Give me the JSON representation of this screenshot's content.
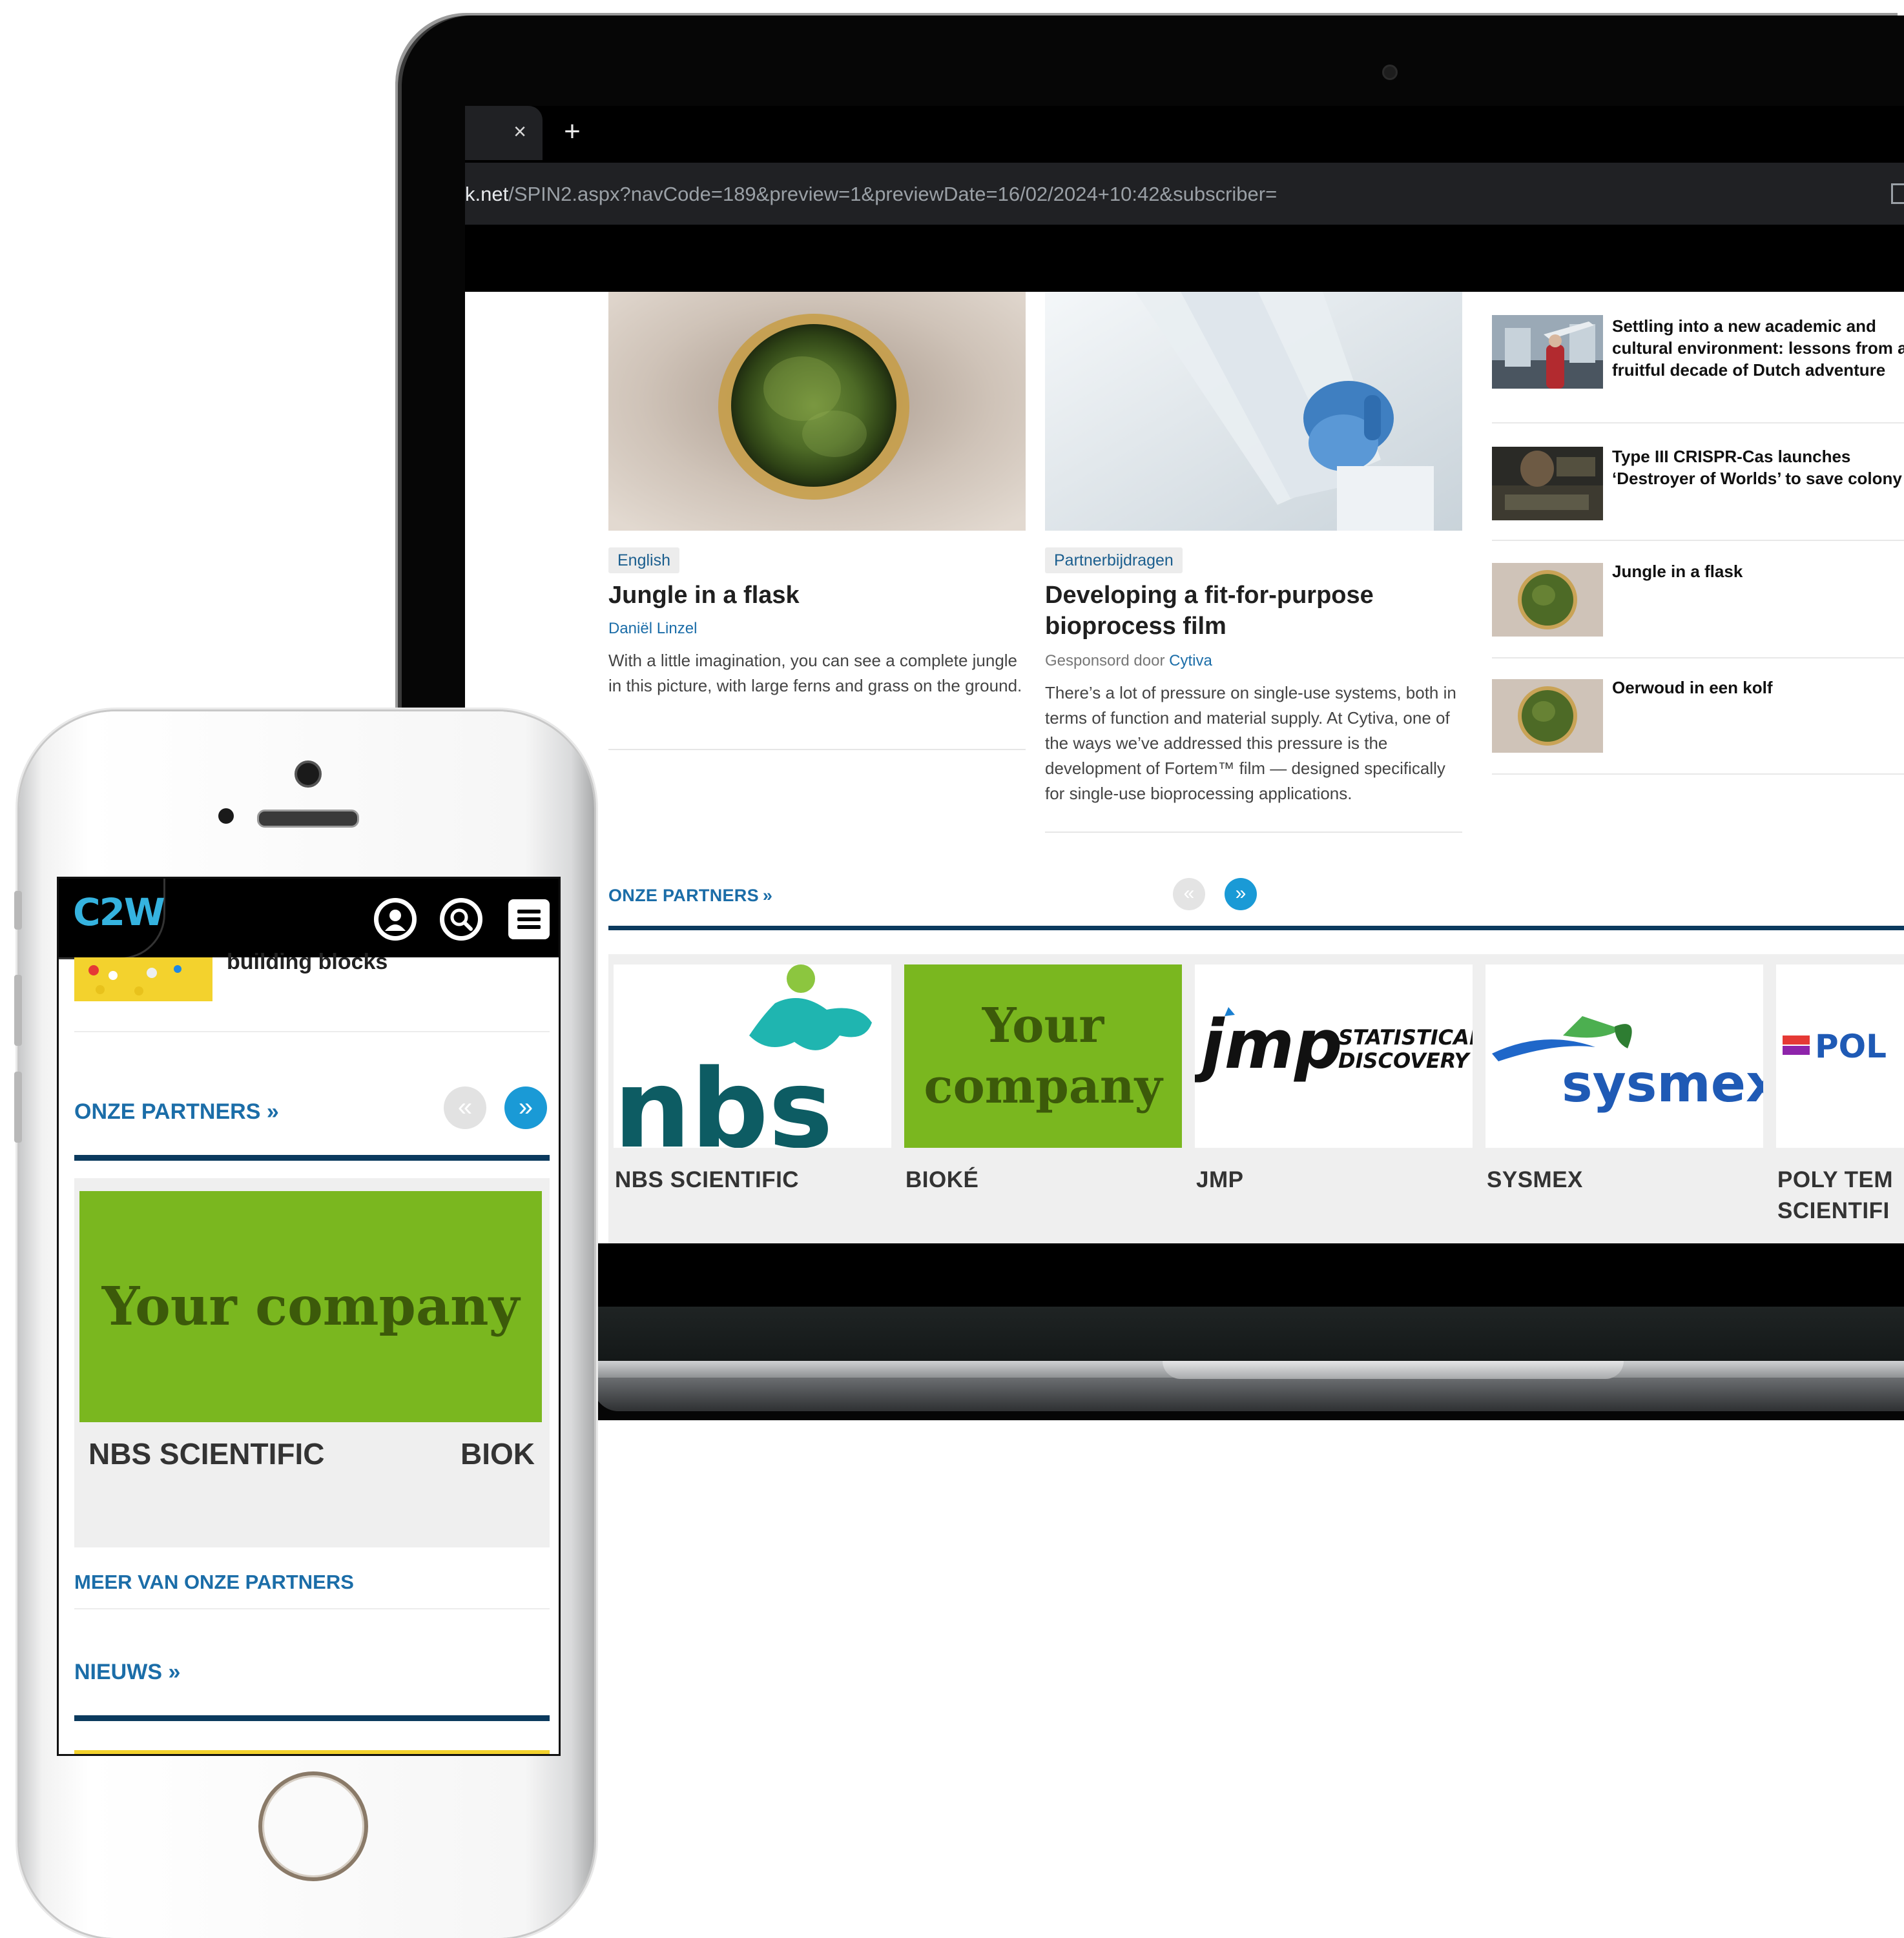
{
  "browser": {
    "tab_close": "×",
    "new_tab": "+",
    "address_host": "k.net",
    "address_path": "/SPIN2.aspx?navCode=189&preview=1&previewDate=16/02/2024+10:42&subscriber="
  },
  "articles": [
    {
      "tag": "English",
      "title": "Jungle in a flask",
      "author": "Daniël Linzel",
      "body": "With a little imagination, you can see a complete jungle in this picture, with large ferns and grass on the ground."
    },
    {
      "tag": "Partnerbijdragen",
      "title": "Developing a fit-for-purpose bioprocess film",
      "sponsor_prefix": "Gesponsord door",
      "sponsor": "Cytiva",
      "body": "There’s a lot of pressure on single-use systems, both in terms of function and material supply. At Cytiva, one of the ways we’ve addressed this pressure is the development of Fortem™ film — designed specifically for single-use bioprocessing applications."
    }
  ],
  "sidebar": [
    {
      "title": "Settling into a new academic and cultural environment: lessons from a fruitful decade of Dutch adventure"
    },
    {
      "title": "Type III CRISPR-Cas launches ‘Destroyer of Worlds’ to save colony"
    },
    {
      "title": "Jungle in a flask"
    },
    {
      "title": "Oerwoud in een kolf"
    }
  ],
  "partners": {
    "heading": "ONZE PARTNERS",
    "chevron": "»",
    "prev": "«",
    "next": "»",
    "items": [
      {
        "name": "NBS SCIENTIFIC",
        "logo_text": "nbs"
      },
      {
        "name": "BIOKÉ",
        "logo_text": "Your company"
      },
      {
        "name": "JMP",
        "logo_text": "jmp",
        "logo_sub1": "STATISTICAL",
        "logo_sub2": "DISCOVERY"
      },
      {
        "name": "SYSMEX",
        "logo_text": "sysmex"
      },
      {
        "name": "POLY TEM SCIENTIFI",
        "logo_text": "POL"
      }
    ]
  },
  "phone": {
    "logo": "C2W",
    "prev_item_text": "building blocks",
    "partners_heading": "ONZE PARTNERS",
    "chevron": "»",
    "prev": "«",
    "next": "»",
    "card_logo_text": "Your company",
    "card_name_1": "NBS SCIENTIFIC",
    "card_name_2": "BIOK",
    "more_partners": "MEER VAN ONZE PARTNERS",
    "news_heading": "NIEUWS"
  },
  "colors": {
    "accent_blue": "#1b6da8",
    "rule_navy": "#0b3a5e",
    "pager_blue": "#1a9ad6",
    "your_company_green": "#7ab71f"
  }
}
